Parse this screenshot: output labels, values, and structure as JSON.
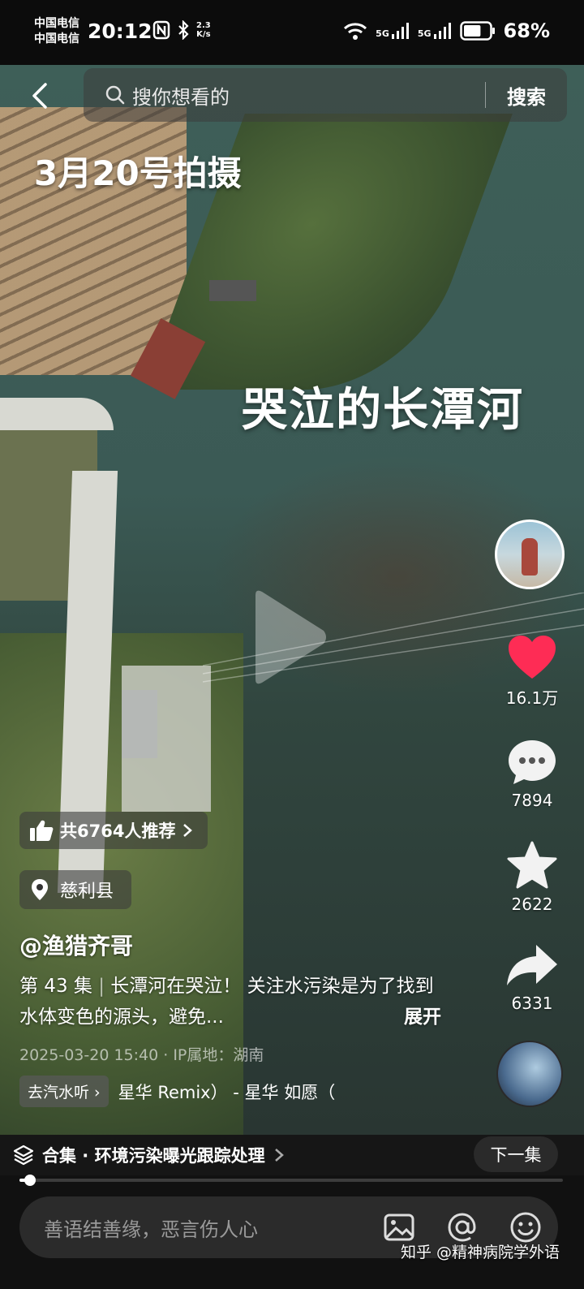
{
  "status_bar": {
    "carrier1": "中国电信",
    "carrier2": "中国电信",
    "time": "20:12",
    "net_speed_value": "2.3",
    "net_speed_unit": "K/s",
    "signal1": "5G",
    "signal2": "5G",
    "battery": "68%",
    "battery_level": 0.68
  },
  "search": {
    "placeholder": "搜你想看的",
    "button": "搜索"
  },
  "video": {
    "overlay_date": "3月20号拍摄",
    "overlay_title": "哭泣的长潭河"
  },
  "rail": {
    "likes": "16.1万",
    "comments": "7894",
    "favorites": "2622",
    "shares": "6331"
  },
  "info": {
    "recommend": "共6764人推荐",
    "location": "慈利县",
    "author": "@渔猎齐哥",
    "episode": "第 43 集",
    "description": "长潭河在哭泣！ 关注水污染是为了找到水体变色的源头，避免...",
    "expand": "展开",
    "meta": "2025-03-20 15:40 · IP属地：湖南",
    "music_chip": "去汽水听 ›",
    "music_title": "星华 Remix） - 星华    如愿（"
  },
  "collection": {
    "label": "合集 · 环境污染曝光跟踪处理",
    "next": "下一集",
    "progress": 0.02
  },
  "comment_bar": {
    "placeholder": "善语结善缘，恶言伤人心"
  },
  "watermark": "知乎 @精神病院学外语",
  "colors": {
    "like": "#fe2c55",
    "background": "#111111"
  }
}
